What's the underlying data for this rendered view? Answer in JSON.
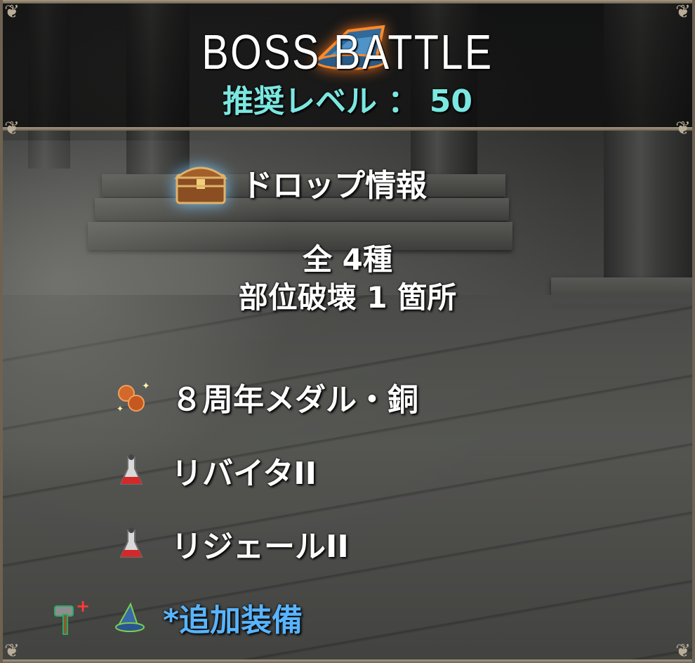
{
  "header": {
    "title": "BOSS BATTLE",
    "level_text": "推奨レベル ： 50",
    "badge_icon": "wizard-hat-icon"
  },
  "drop_info": {
    "title": "ドロップ情報",
    "icon": "treasure-chest-icon",
    "total": "全 4種",
    "part_break": "部位破壊 1 箇所"
  },
  "drops": [
    {
      "label": "８周年メダル・銅",
      "icon": "bronze-medal-icon"
    },
    {
      "label": "リバイタII",
      "icon": "potion-flask-icon"
    },
    {
      "label": "リジェールII",
      "icon": "potion-flask-icon"
    },
    {
      "label": "*追加装備",
      "icon": "wizard-hat-icon",
      "extra_icon": "hammer-plus-icon",
      "color": "#59b4ff"
    }
  ]
}
